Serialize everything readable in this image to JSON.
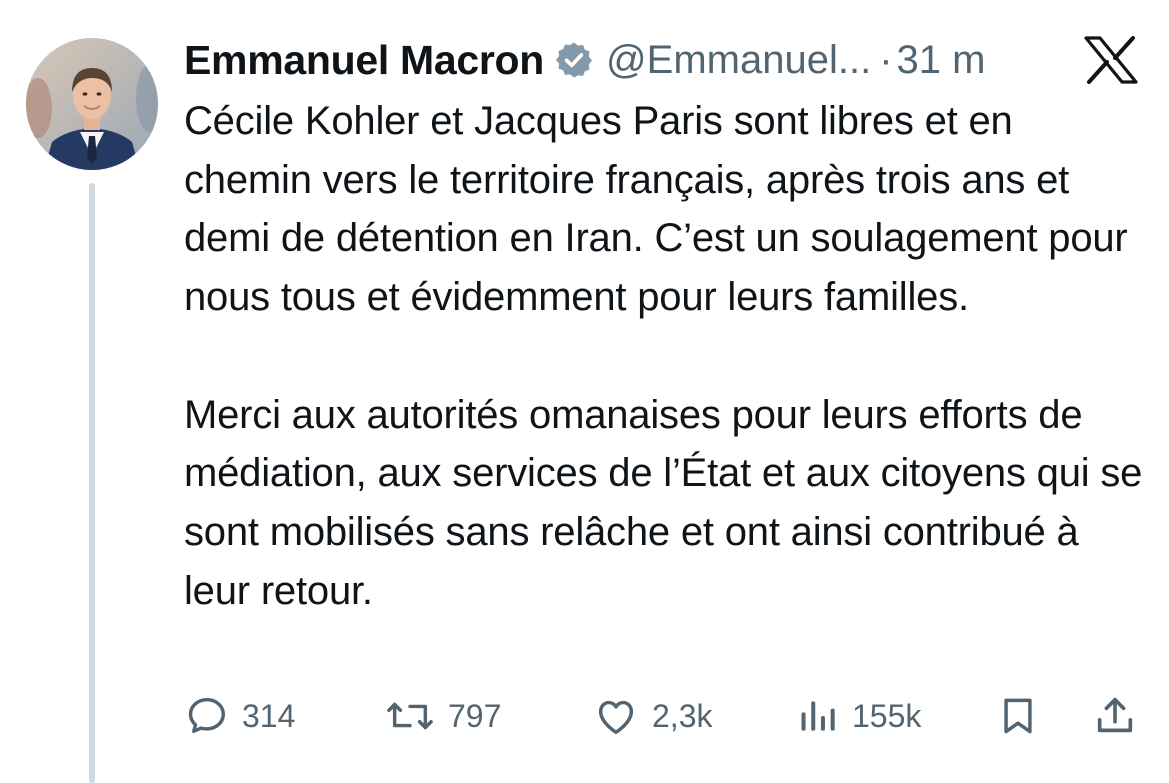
{
  "author": {
    "display_name": "Emmanuel Macron",
    "handle": "@Emmanuel...",
    "separator": "·",
    "timestamp": "31 m",
    "verified_color": "#829aab"
  },
  "tweet": {
    "paragraphs": [
      "Cécile Kohler et Jacques Paris sont libres et en chemin vers le territoire français, après trois ans et demi de détention en Iran. C’est un soulagement pour nous tous et évidemment pour leurs familles.",
      "Merci aux autorités omanaises pour leurs efforts de médiation, aux services de l’État et aux citoyens qui se sont mobilisés sans relâche et ont ainsi contribué à leur retour."
    ]
  },
  "metrics": {
    "replies": "314",
    "reposts": "797",
    "likes": "2,3k",
    "views": "155k"
  },
  "icons": {
    "platform": "x-logo",
    "actions": [
      "reply-icon",
      "repost-icon",
      "like-icon",
      "views-icon",
      "bookmark-icon",
      "share-icon"
    ]
  },
  "colors": {
    "text": "#0f1419",
    "muted": "#536471",
    "thread_line": "#cfd9de"
  }
}
